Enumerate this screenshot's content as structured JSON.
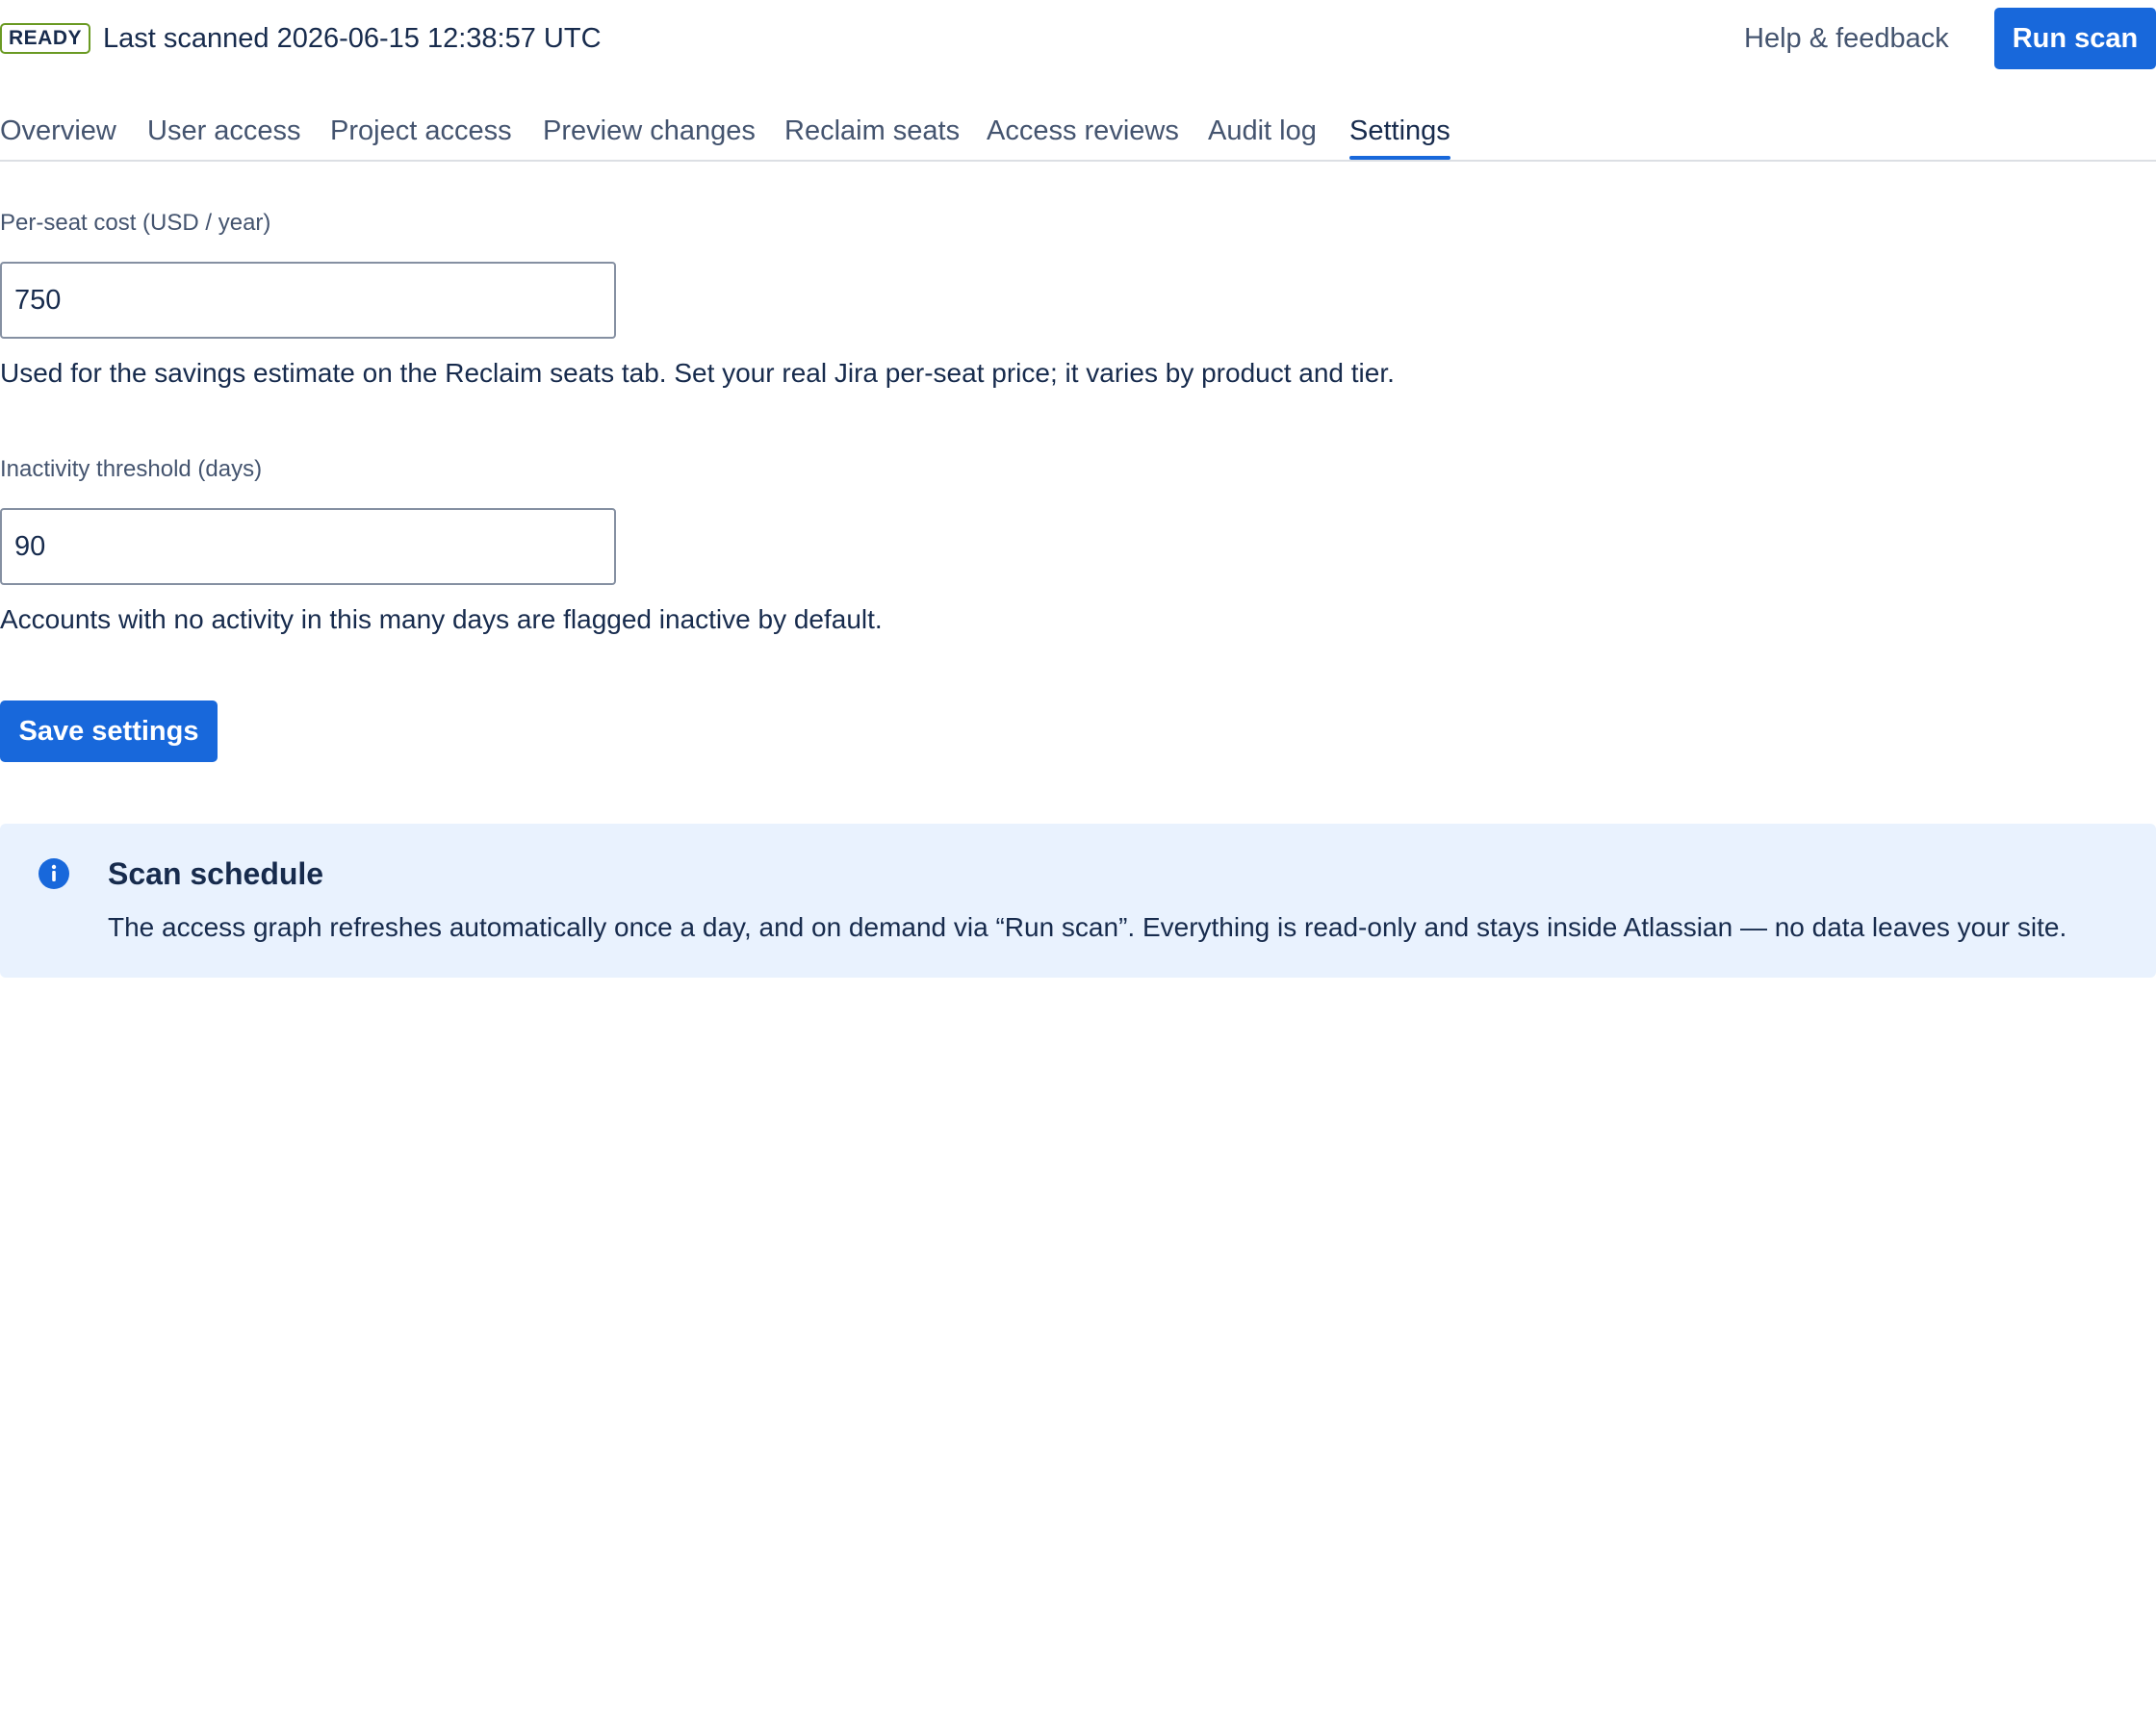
{
  "header": {
    "status_badge": "READY",
    "last_scanned": "Last scanned 2026-06-15 12:38:57 UTC",
    "help_link": "Help & feedback",
    "run_scan_label": "Run scan"
  },
  "tabs": [
    {
      "label": "Overview"
    },
    {
      "label": "User access"
    },
    {
      "label": "Project access"
    },
    {
      "label": "Preview changes"
    },
    {
      "label": "Reclaim seats"
    },
    {
      "label": "Access reviews"
    },
    {
      "label": "Audit log"
    },
    {
      "label": "Settings",
      "active": true
    }
  ],
  "settings": {
    "per_seat_cost": {
      "label": "Per-seat cost (USD / year)",
      "value": "750",
      "help": "Used for the savings estimate on the Reclaim seats tab. Set your real Jira per-seat price; it varies by product and tier."
    },
    "inactivity_threshold": {
      "label": "Inactivity threshold (days)",
      "value": "90",
      "help": "Accounts with no activity in this many days are flagged inactive by default."
    },
    "save_label": "Save settings"
  },
  "info_panel": {
    "icon": "info-icon",
    "title": "Scan schedule",
    "body": "The access graph refreshes automatically once a day, and on demand via “Run scan”. Everything is read-only and stays inside Atlassian — no data leaves your site."
  },
  "colors": {
    "accent": "#1868db",
    "badge_border": "#6a9a23",
    "info_background": "#e9f2fe",
    "text": "#172b4d",
    "subtle_text": "#44546f"
  }
}
